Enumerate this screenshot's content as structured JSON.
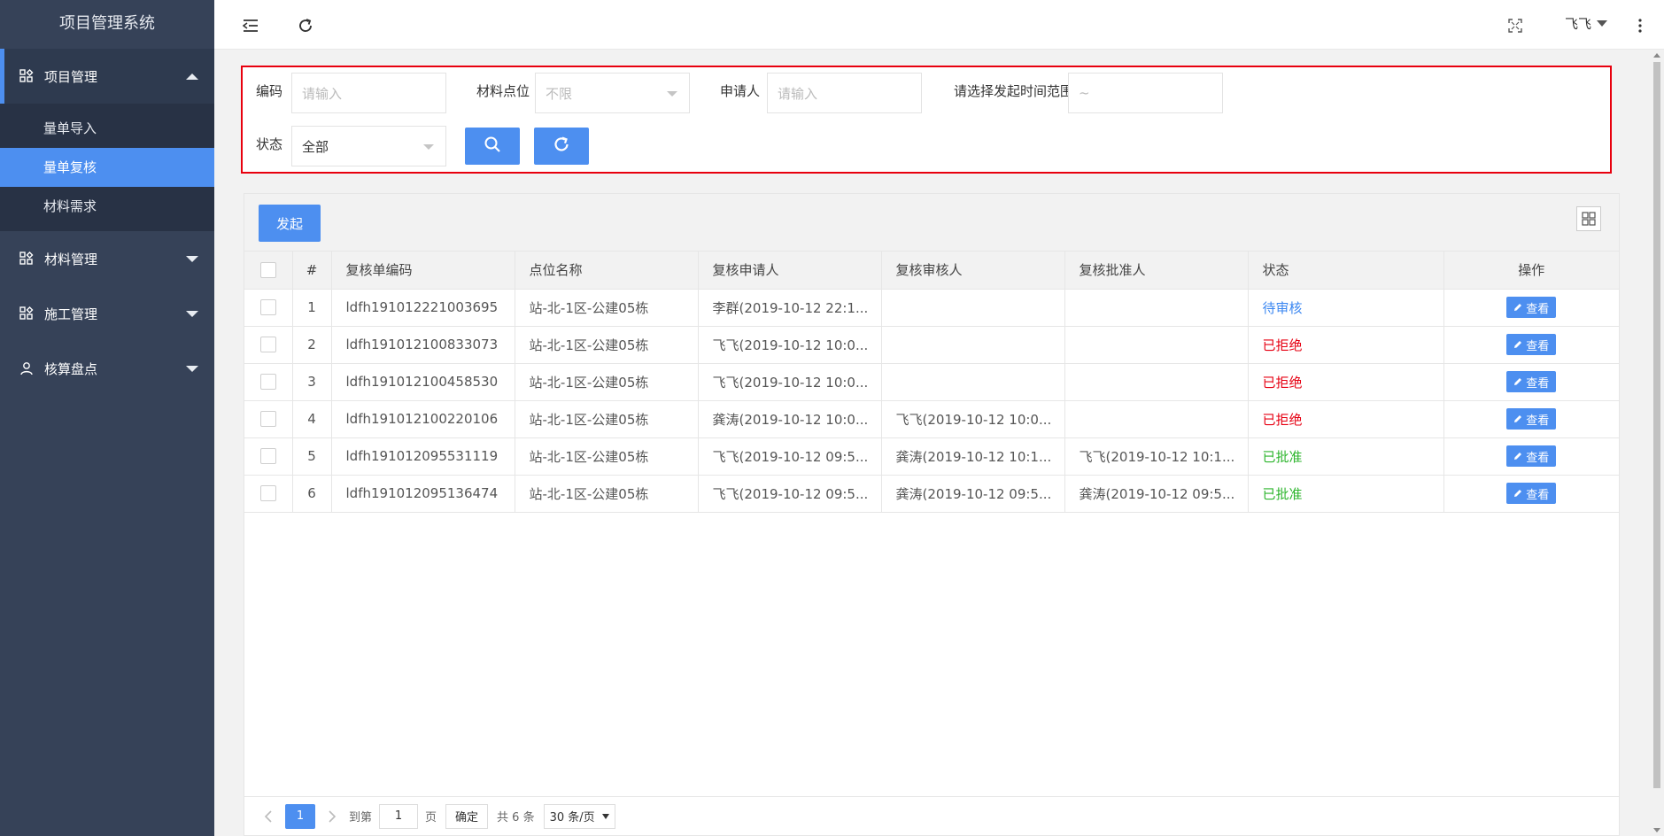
{
  "app": {
    "title": "项目管理系统"
  },
  "sidebar": {
    "groups": [
      {
        "label": "项目管理",
        "expanded": true,
        "items": [
          {
            "label": "量单导入",
            "active": false
          },
          {
            "label": "量单复核",
            "active": true
          },
          {
            "label": "材料需求",
            "active": false
          }
        ]
      },
      {
        "label": "材料管理",
        "expanded": false
      },
      {
        "label": "施工管理",
        "expanded": false
      },
      {
        "label": "核算盘点",
        "expanded": false
      }
    ]
  },
  "header": {
    "user": "飞飞"
  },
  "filters": {
    "code_label": "编码",
    "code_placeholder": "请输入",
    "location_label": "材料点位",
    "location_value": "不限",
    "applicant_label": "申请人",
    "applicant_placeholder": "请输入",
    "range_label": "请选择发起时间范围",
    "range_value": "~",
    "status_label": "状态",
    "status_value": "全部"
  },
  "toolbar": {
    "start_label": "发起"
  },
  "table": {
    "columns": [
      "#",
      "复核单编码",
      "点位名称",
      "复核申请人",
      "复核审核人",
      "复核批准人",
      "状态",
      "操作"
    ],
    "rows": [
      {
        "no": "1",
        "code": "ldfh191012221003695",
        "location": "站-北-1区-公建05栋",
        "applicant": "李群(2019-10-12 22:1...",
        "reviewer": "",
        "approver": "",
        "status": "待审核",
        "status_type": "pending"
      },
      {
        "no": "2",
        "code": "ldfh191012100833073",
        "location": "站-北-1区-公建05栋",
        "applicant": "飞飞(2019-10-12 10:0...",
        "reviewer": "",
        "approver": "",
        "status": "已拒绝",
        "status_type": "reject"
      },
      {
        "no": "3",
        "code": "ldfh191012100458530",
        "location": "站-北-1区-公建05栋",
        "applicant": "飞飞(2019-10-12 10:0...",
        "reviewer": "",
        "approver": "",
        "status": "已拒绝",
        "status_type": "reject"
      },
      {
        "no": "4",
        "code": "ldfh191012100220106",
        "location": "站-北-1区-公建05栋",
        "applicant": "龚涛(2019-10-12 10:0...",
        "reviewer": "飞飞(2019-10-12 10:0...",
        "approver": "",
        "status": "已拒绝",
        "status_type": "reject"
      },
      {
        "no": "5",
        "code": "ldfh191012095531119",
        "location": "站-北-1区-公建05栋",
        "applicant": "飞飞(2019-10-12 09:5...",
        "reviewer": "龚涛(2019-10-12 10:1...",
        "approver": "飞飞(2019-10-12 10:1...",
        "status": "已批准",
        "status_type": "approve"
      },
      {
        "no": "6",
        "code": "ldfh191012095136474",
        "location": "站-北-1区-公建05栋",
        "applicant": "飞飞(2019-10-12 09:5...",
        "reviewer": "龚涛(2019-10-12 09:5...",
        "approver": "龚涛(2019-10-12 09:5...",
        "status": "已批准",
        "status_type": "approve"
      }
    ],
    "action_label": "查看"
  },
  "pager": {
    "current_page": "1",
    "goto_label": "到第",
    "goto_value": "1",
    "page_unit": "页",
    "confirm_label": "确定",
    "total_label": "共 6 条",
    "page_size": "30 条/页"
  },
  "colors": {
    "accent": "#4d8ff0",
    "sidebar": "#364258",
    "pending": "#3b87f1",
    "reject": "#e60012",
    "approve": "#2db52d",
    "highlight_border": "#e8000e"
  }
}
